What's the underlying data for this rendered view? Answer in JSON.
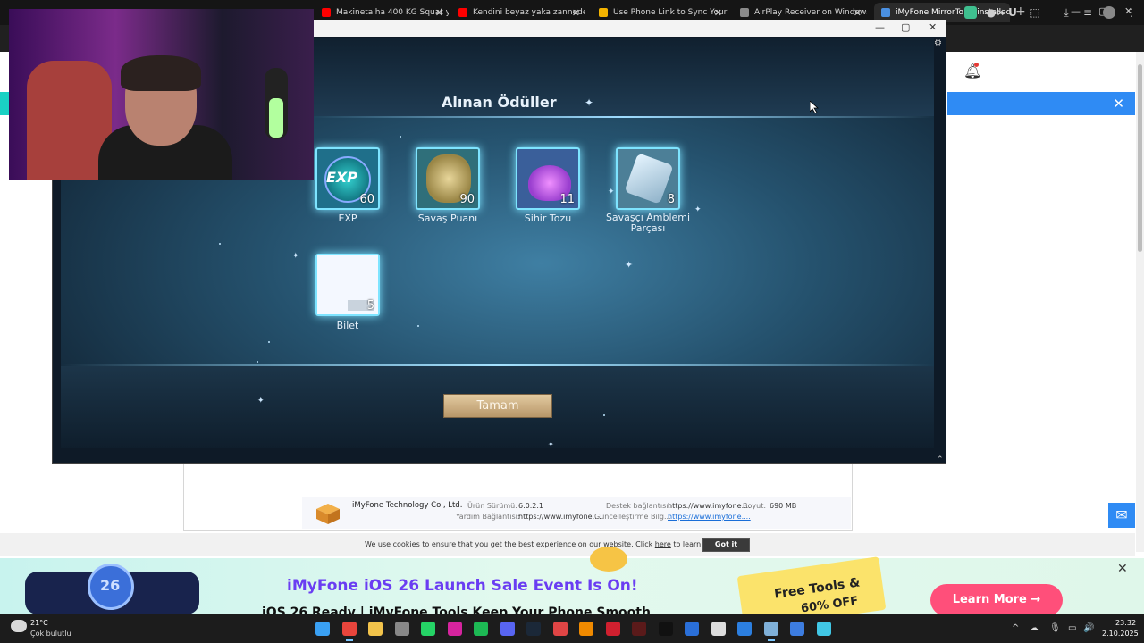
{
  "browser": {
    "tabs": [
      {
        "label": "Makinetalha 400 KG Squat yap",
        "favicon_color": "#ff0000"
      },
      {
        "label": "Kendini beyaz yaka zanneden",
        "favicon_color": "#ff0000"
      },
      {
        "label": "Use Phone Link to Sync Your A",
        "favicon_color": "#f4b400"
      },
      {
        "label": "AirPlay Receiver on Windows",
        "favicon_color": "#8a8a8a"
      },
      {
        "label": "iMyFone MirrorTo Uninstalled",
        "favicon_color": "#4a90e2"
      }
    ],
    "new_tab": "+",
    "window_controls": {
      "minimize": "—",
      "maximize": "▢",
      "close": "✕"
    }
  },
  "mirror_window": {
    "controls": {
      "minimize": "—",
      "maximize": "▢",
      "close": "✕"
    },
    "game": {
      "title": "Alınan Ödüller",
      "rewards": [
        {
          "label": "EXP",
          "quantity": "60",
          "icon": "exp-icon"
        },
        {
          "label": "Savaş Puanı",
          "quantity": "90",
          "icon": "coin-stack-icon"
        },
        {
          "label": "Sihir Tozu",
          "quantity": "11",
          "icon": "magic-dust-icon"
        },
        {
          "label": "Savaşçı Amblemi Parçası",
          "quantity": "8",
          "icon": "emblem-shard-icon"
        },
        {
          "label": "Bilet",
          "quantity": "5",
          "icon": "ticket-icon"
        }
      ],
      "confirm_button": "Tamam",
      "exp_icon_text": "EXP"
    }
  },
  "page": {
    "info": {
      "company": "iMyFone Technology Co., Ltd.",
      "version_label": "Ürün Sürümü:",
      "version_value": "6.0.2.1",
      "support_label": "Destek bağlantısı:",
      "support_value": "https://www.imyfone....",
      "size_label": "Boyut:",
      "size_value": "690 MB",
      "help_label": "Yardım Bağlantısı:",
      "help_value": "https://www.imyfone....",
      "update_label": "Güncelleştirme Bilg...",
      "update_value": "https://www.imyfone...."
    },
    "cookie": {
      "text_before": "We use cookies to ensure that you get the best experience on our website. Click ",
      "link": "here",
      "text_after": " to learn more.",
      "button": "Got it"
    },
    "banner": {
      "title": "iMyFone iOS 26 Launch Sale Event Is On!",
      "subtitle": "iOS 26 Ready | iMyFone Tools Keep Your Phone Smooth",
      "promo_line1": "Free Tools &",
      "promo_line2": "60% OFF",
      "button": "Learn More →",
      "art_number": "26",
      "close": "✕"
    },
    "blue_bar_close": "✕",
    "mail_icon": "✉"
  },
  "taskbar": {
    "weather_temp": "21°C",
    "weather_desc": "Çok bulutlu",
    "time": "23:32",
    "date": "2.10.2025",
    "tray_icons": [
      "^",
      "☁",
      "🎙",
      "▭",
      "🔊"
    ],
    "apps": [
      {
        "name": "windows-start-icon",
        "color": "#3aa0f3"
      },
      {
        "name": "chrome-icon",
        "color": "#e8453c"
      },
      {
        "name": "file-explorer-icon",
        "color": "#f2c34b"
      },
      {
        "name": "browser-icon",
        "color": "#888888"
      },
      {
        "name": "whatsapp-icon",
        "color": "#25d366"
      },
      {
        "name": "instagram-icon",
        "color": "#d6249f"
      },
      {
        "name": "spotify-icon",
        "color": "#1db954"
      },
      {
        "name": "discord-icon",
        "color": "#5865f2"
      },
      {
        "name": "steam-icon",
        "color": "#1b2838"
      },
      {
        "name": "calendar-icon",
        "color": "#e04545"
      },
      {
        "name": "vlc-icon",
        "color": "#f08a00"
      },
      {
        "name": "app-red-icon",
        "color": "#d0202f"
      },
      {
        "name": "app-dark-icon",
        "color": "#5a1a1a"
      },
      {
        "name": "tiktok-icon",
        "color": "#111111"
      },
      {
        "name": "app-blue-icon",
        "color": "#2a6fd8"
      },
      {
        "name": "app-grid-icon",
        "color": "#dddddd"
      },
      {
        "name": "store-icon",
        "color": "#2c7fe0"
      },
      {
        "name": "monitor-icon",
        "color": "#7fb0d8"
      },
      {
        "name": "mirror-app-icon",
        "color": "#3d7de0"
      },
      {
        "name": "iMyFone-icon",
        "color": "#41c7e5"
      }
    ]
  }
}
